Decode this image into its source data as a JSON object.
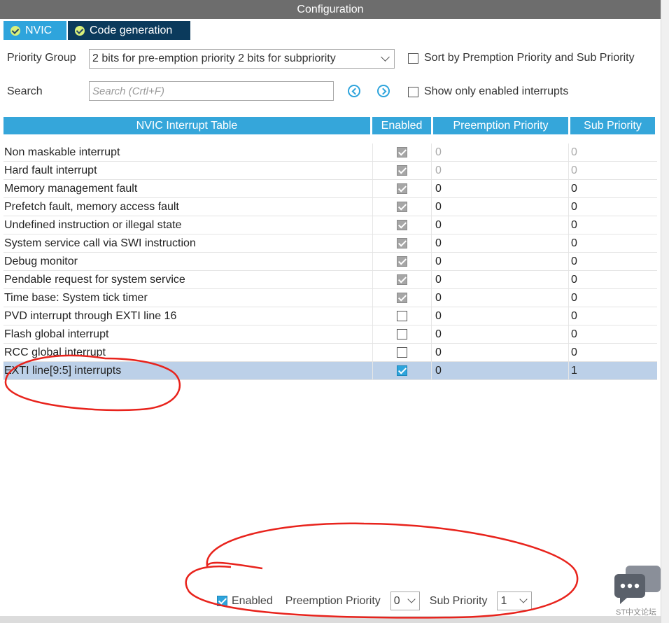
{
  "window": {
    "title": "Configuration"
  },
  "tabs": [
    {
      "label": "NVIC"
    },
    {
      "label": "Code generation"
    }
  ],
  "controls": {
    "priority_group_label": "Priority Group",
    "priority_group_value": "2 bits for pre-emption priority 2 bits for subpriority",
    "sort_label": "Sort by Premption Priority and Sub Priority",
    "search_label": "Search",
    "search_placeholder": "Search (Crtl+F)",
    "show_enabled_label": "Show only enabled interrupts"
  },
  "table": {
    "columns": [
      "NVIC Interrupt Table",
      "Enabled",
      "Preemption Priority",
      "Sub Priority"
    ],
    "rows": [
      {
        "name": "Non maskable interrupt",
        "enabled": true,
        "locked": true,
        "preemption": "0",
        "sub": "0",
        "disabled_text": true
      },
      {
        "name": "Hard fault interrupt",
        "enabled": true,
        "locked": true,
        "preemption": "0",
        "sub": "0",
        "disabled_text": true
      },
      {
        "name": "Memory management fault",
        "enabled": true,
        "locked": true,
        "preemption": "0",
        "sub": "0"
      },
      {
        "name": "Prefetch fault, memory access fault",
        "enabled": true,
        "locked": true,
        "preemption": "0",
        "sub": "0"
      },
      {
        "name": "Undefined instruction or illegal state",
        "enabled": true,
        "locked": true,
        "preemption": "0",
        "sub": "0"
      },
      {
        "name": "System service call via SWI instruction",
        "enabled": true,
        "locked": true,
        "preemption": "0",
        "sub": "0"
      },
      {
        "name": "Debug monitor",
        "enabled": true,
        "locked": true,
        "preemption": "0",
        "sub": "0"
      },
      {
        "name": "Pendable request for system service",
        "enabled": true,
        "locked": true,
        "preemption": "0",
        "sub": "0"
      },
      {
        "name": "Time base: System tick timer",
        "enabled": true,
        "locked": true,
        "preemption": "0",
        "sub": "0"
      },
      {
        "name": "PVD interrupt through EXTI line 16",
        "enabled": false,
        "preemption": "0",
        "sub": "0"
      },
      {
        "name": "Flash global interrupt",
        "enabled": false,
        "preemption": "0",
        "sub": "0"
      },
      {
        "name": "RCC global interrupt",
        "enabled": false,
        "preemption": "0",
        "sub": "0"
      },
      {
        "name": "EXTI line[9:5] interrupts",
        "enabled": true,
        "selected": true,
        "preemption": "0",
        "sub": "1"
      }
    ]
  },
  "bottom": {
    "enabled_label": "Enabled",
    "preemption_label": "Preemption Priority",
    "preemption_value": "0",
    "sub_label": "Sub Priority",
    "sub_value": "1"
  },
  "watermark": "ST中文论坛",
  "colors": {
    "accent": "#2ea4dc",
    "tab_dark": "#0b3a5c",
    "selection": "#bcd0e8",
    "annotation": "#e8231c"
  }
}
